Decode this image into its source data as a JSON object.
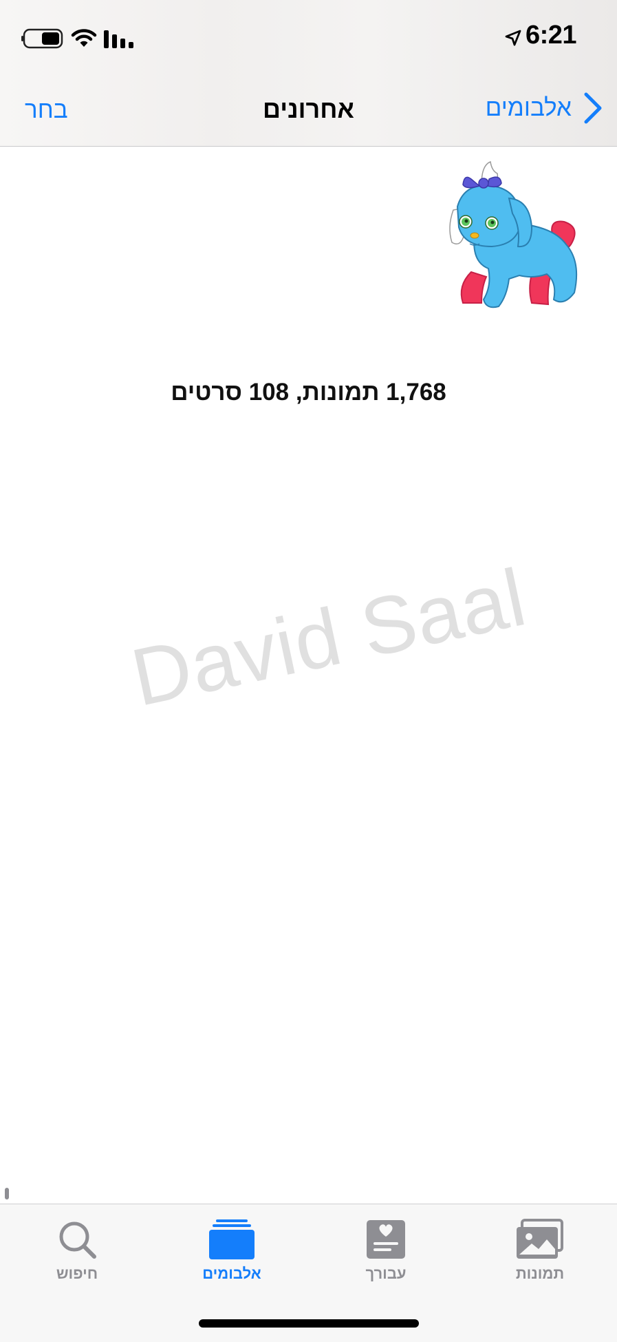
{
  "status_bar": {
    "time": "6:21",
    "icons": [
      "battery-icon",
      "wifi-icon",
      "signal-icon",
      "location-arrow-icon"
    ]
  },
  "nav": {
    "back_label": "אלבומים",
    "title": "אחרונים",
    "select_label": "בחר"
  },
  "content": {
    "count_text": "1,768 תמונות, 108 סרטים",
    "watermark": "David Saal"
  },
  "tabs": [
    {
      "label": "חיפוש",
      "icon": "search-icon",
      "active": false
    },
    {
      "label": "אלבומים",
      "icon": "albums-icon",
      "active": true
    },
    {
      "label": "עבורך",
      "icon": "for-you-icon",
      "active": false
    },
    {
      "label": "תמונות",
      "icon": "photos-icon",
      "active": false
    }
  ],
  "colors": {
    "accent": "#147efb",
    "inactive": "#8e8e93"
  }
}
